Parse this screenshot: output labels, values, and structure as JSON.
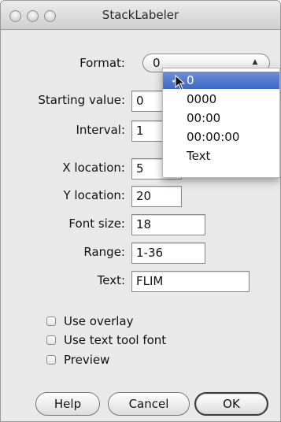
{
  "window": {
    "title": "StackLabeler"
  },
  "form": {
    "format_label": "Format:",
    "format_value": "0",
    "starting_label": "Starting value:",
    "starting_value": "0",
    "interval_label": "Interval:",
    "interval_value": "1",
    "xloc_label": "X location:",
    "xloc_value": "5",
    "yloc_label": "Y location:",
    "yloc_value": "20",
    "fontsize_label": "Font size:",
    "fontsize_value": "18",
    "range_label": "Range:",
    "range_value": "1-36",
    "text_label": "Text:",
    "text_value": "FLIM"
  },
  "format_menu": {
    "check_mark": "✓",
    "options": [
      "0",
      "0000",
      "00:00",
      "00:00:00",
      "Text"
    ],
    "selected_index": 0
  },
  "checkboxes": [
    {
      "label": "Use overlay",
      "checked": false
    },
    {
      "label": "Use text tool font",
      "checked": false
    },
    {
      "label": "Preview",
      "checked": false
    }
  ],
  "buttons": {
    "help": "Help",
    "cancel": "Cancel",
    "ok": "OK"
  },
  "colors": {
    "window_bg": "#e9e9e9",
    "menu_highlight": "#3f67c6"
  }
}
